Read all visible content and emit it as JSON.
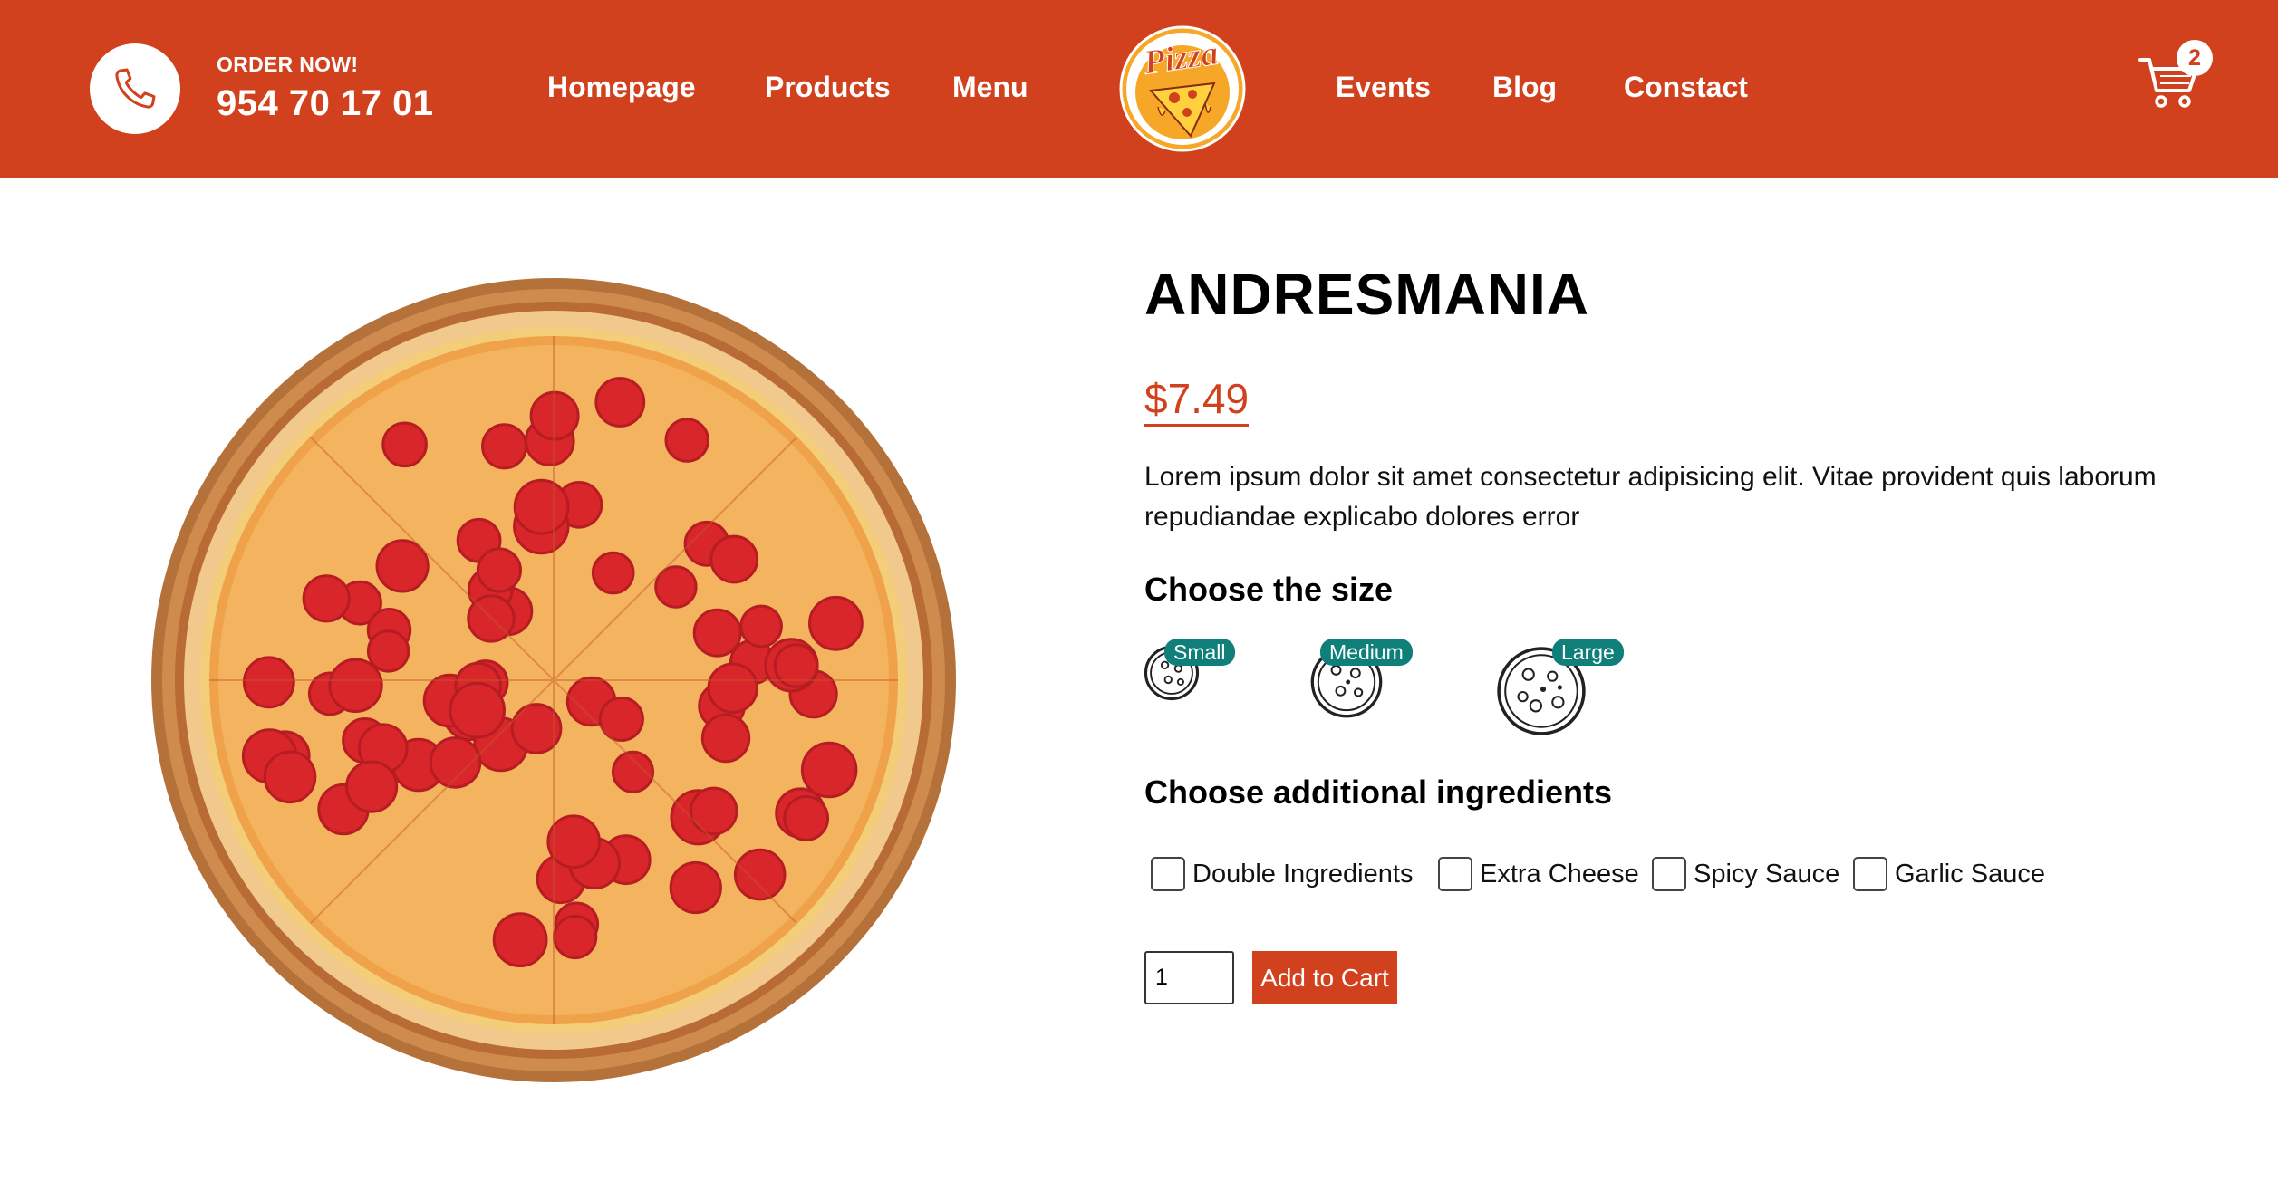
{
  "header": {
    "order_label": "ORDER NOW!",
    "phone_number": "954 70 17 01",
    "nav_left": [
      "Homepage",
      "Products",
      "Menu"
    ],
    "nav_right": [
      "Events",
      "Blog",
      "Constact"
    ],
    "logo_text": "Pizza",
    "cart_count": "2",
    "icons": {
      "call": "phone-icon",
      "cart": "cart-icon"
    }
  },
  "product": {
    "name": "ANDRESMANIA",
    "price": "$7.49",
    "description": "Lorem ipsum dolor sit amet consectetur adipisicing elit. Vitae provident quis laborum repudiandae explicabo dolores error"
  },
  "size_section": {
    "title": "Choose the size",
    "options": [
      "Small",
      "Medium",
      "Large"
    ]
  },
  "ingredients_section": {
    "title": "Choose additional ingredients",
    "options": [
      "Double Ingredients",
      "Extra Cheese",
      "Spicy Sauce",
      "Garlic Sauce"
    ]
  },
  "cart_controls": {
    "quantity_value": "1",
    "add_button_label": "Add to Cart"
  },
  "colors": {
    "brand": "#d1411e",
    "tag": "#0f7f7a",
    "text": "#000000"
  }
}
